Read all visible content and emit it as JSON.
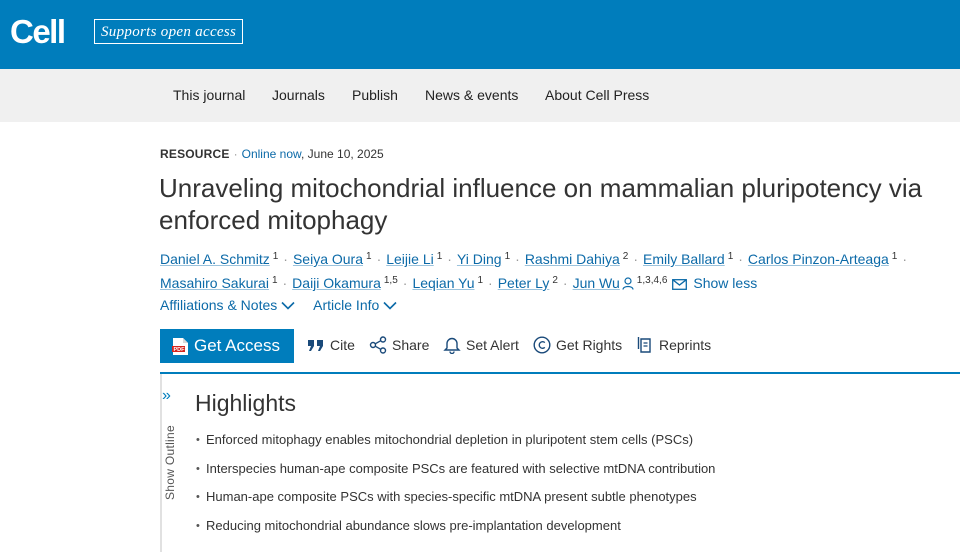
{
  "header": {
    "logo": "Cell",
    "open_access_badge": "Supports open access",
    "brand_color": "#007dbc"
  },
  "nav": {
    "items": [
      "This journal",
      "Journals",
      "Publish",
      "News & events",
      "About Cell Press"
    ]
  },
  "article": {
    "type": "RESOURCE",
    "online_status": "Online now",
    "date": ", June 10, 2025",
    "title": "Unraveling mitochondrial influence on mammalian pluripotency via enforced mitophagy",
    "authors": [
      {
        "name": "Daniel A. Schmitz",
        "sup": "1"
      },
      {
        "name": "Seiya Oura",
        "sup": "1"
      },
      {
        "name": "Leijie Li",
        "sup": "1"
      },
      {
        "name": "Yi Ding",
        "sup": "1"
      },
      {
        "name": "Rashmi Dahiya",
        "sup": "2"
      },
      {
        "name": "Emily Ballard",
        "sup": "1"
      },
      {
        "name": "Carlos Pinzon-Arteaga",
        "sup": "1"
      },
      {
        "name": "Masahiro Sakurai",
        "sup": "1"
      },
      {
        "name": "Daiji Okamura",
        "sup": "1,5"
      },
      {
        "name": "Leqian Yu",
        "sup": "1"
      },
      {
        "name": "Peter Ly",
        "sup": "2"
      },
      {
        "name": "Jun Wu",
        "sup": "1,3,4,6"
      }
    ],
    "show_less": "Show less",
    "affiliations_label": "Affiliations & Notes",
    "article_info_label": "Article Info"
  },
  "actions": {
    "get_access": "Get Access",
    "cite": "Cite",
    "share": "Share",
    "set_alert": "Set Alert",
    "get_rights": "Get Rights",
    "reprints": "Reprints"
  },
  "outline": {
    "label": "Show Outline",
    "chevron": "»"
  },
  "highlights": {
    "title": "Highlights",
    "items": [
      "Enforced mitophagy enables mitochondrial depletion in pluripotent stem cells (PSCs)",
      "Interspecies human-ape composite PSCs are featured with selective mtDNA contribution",
      "Human-ape composite PSCs with species-specific mtDNA present subtle phenotypes",
      "Reducing mitochondrial abundance slows pre-implantation development"
    ]
  }
}
